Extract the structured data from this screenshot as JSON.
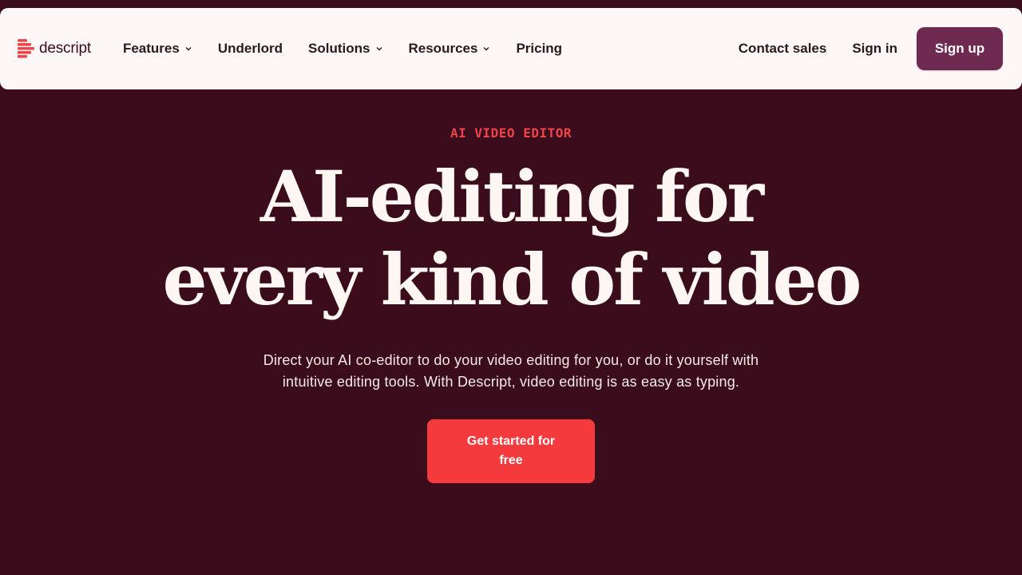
{
  "header": {
    "logo": {
      "text": "descript",
      "icon": "descript-logo-icon"
    },
    "nav": [
      {
        "label": "Features",
        "dropdown": true
      },
      {
        "label": "Underlord",
        "dropdown": false
      },
      {
        "label": "Solutions",
        "dropdown": true
      },
      {
        "label": "Resources",
        "dropdown": true
      },
      {
        "label": "Pricing",
        "dropdown": false
      }
    ],
    "contact_sales": "Contact sales",
    "sign_in": "Sign in",
    "sign_up": "Sign up"
  },
  "hero": {
    "eyebrow": "AI VIDEO EDITOR",
    "headline_line1": "AI-editing for",
    "headline_line2": "every kind of video",
    "subtext": "Direct your AI co-editor to do your video editing for you, or do it yourself with intuitive editing tools. With Descript, video editing is as easy as typing.",
    "cta": "Get started for free"
  },
  "colors": {
    "background": "#3a0c1c",
    "header_bg": "#fdf7f7",
    "accent_red": "#f43a3c",
    "signup_bg": "#6e2a50",
    "eyebrow": "#f0444a"
  }
}
